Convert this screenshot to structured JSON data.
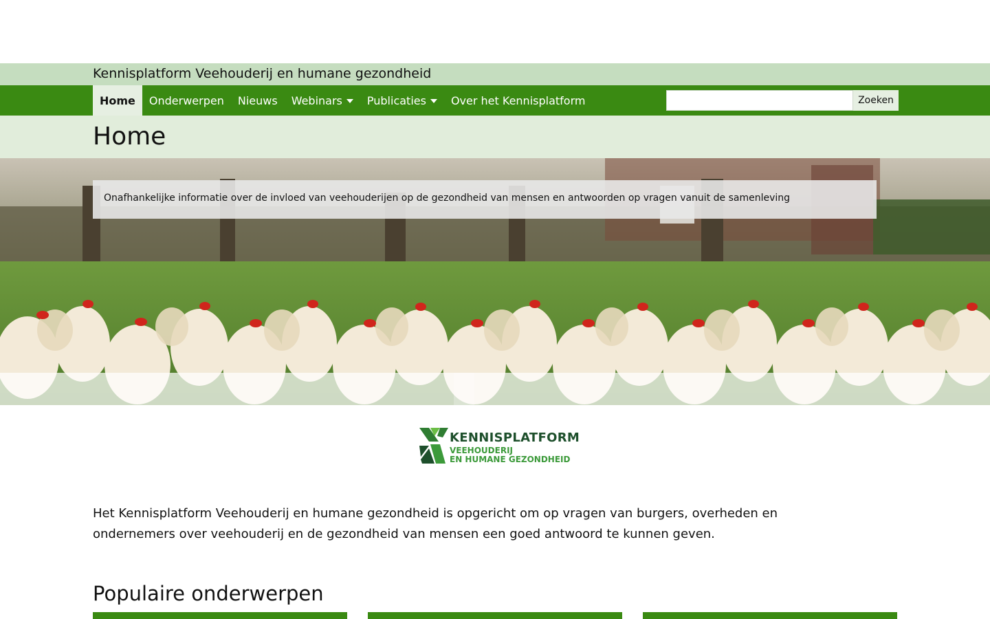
{
  "site": {
    "title": "Kennisplatform Veehouderij en humane gezondheid"
  },
  "nav": {
    "items": [
      {
        "label": "Home",
        "active": true,
        "has_dropdown": false
      },
      {
        "label": "Onderwerpen",
        "active": false,
        "has_dropdown": false
      },
      {
        "label": "Nieuws",
        "active": false,
        "has_dropdown": false
      },
      {
        "label": "Webinars",
        "active": false,
        "has_dropdown": true
      },
      {
        "label": "Publicaties",
        "active": false,
        "has_dropdown": true
      },
      {
        "label": "Over het Kennisplatform",
        "active": false,
        "has_dropdown": false
      }
    ],
    "search": {
      "value": "",
      "placeholder": "",
      "button_label": "Zoeken"
    }
  },
  "page": {
    "title": "Home"
  },
  "hero": {
    "caption": "Onafhankelijke informatie over de invloed van veehouderijen op de gezondheid van mensen en antwoorden op vragen vanuit de samenleving"
  },
  "logo": {
    "line1": "KENNISPLATFORM",
    "line2": "VEEHOUDERIJ",
    "line3": "EN HUMANE GEZONDHEID"
  },
  "intro": {
    "text": "Het Kennisplatform Veehouderij en humane gezondheid is opgericht om op vragen van burgers, overheden en ondernemers over veehouderij en de gezondheid van mensen een goed antwoord te kunnen geven."
  },
  "popular": {
    "title": "Populaire onderwerpen",
    "card_count": 3
  },
  "colors": {
    "nav_green": "#3a8a12",
    "strip_green": "#c5ddbf",
    "band_green": "#e1eddb",
    "active_tab": "#e6efe2",
    "logo_dark": "#1d4f2b",
    "logo_green": "#3c9a3a"
  }
}
